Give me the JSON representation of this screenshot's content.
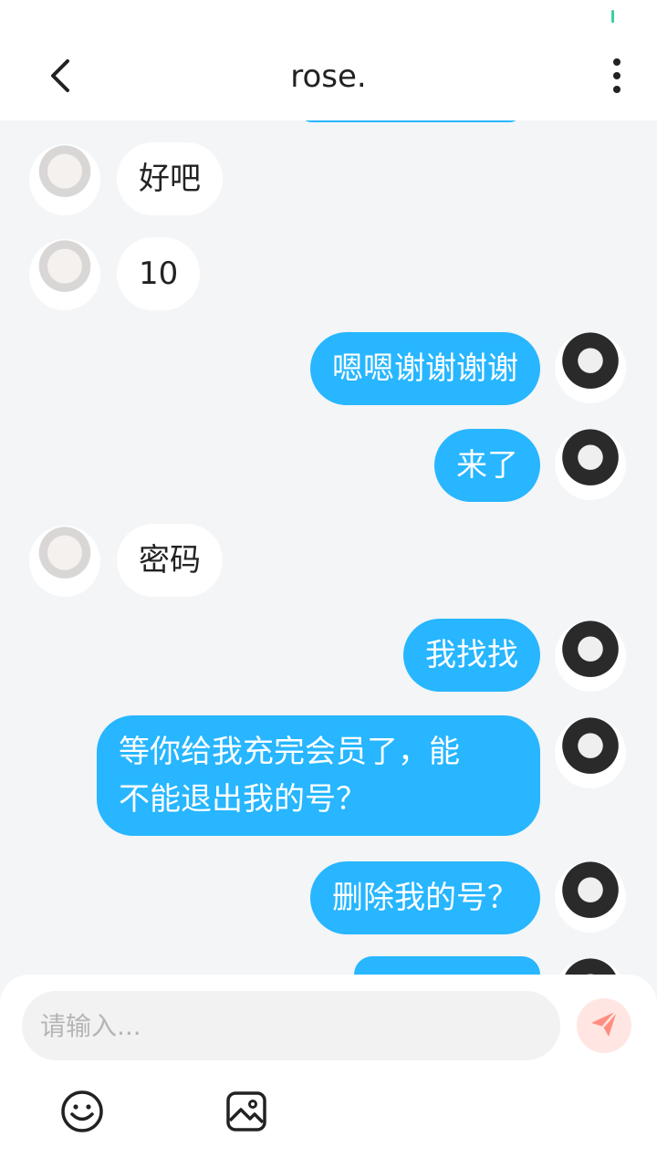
{
  "header": {
    "title": "rose."
  },
  "messages": [
    {
      "side": "in",
      "text": "好吧"
    },
    {
      "side": "in",
      "text": "10"
    },
    {
      "side": "out",
      "text": "嗯嗯谢谢谢谢"
    },
    {
      "side": "out",
      "text": "来了"
    },
    {
      "side": "in",
      "text": "密码"
    },
    {
      "side": "out",
      "text": "我找找"
    },
    {
      "side": "out",
      "text_line1": "等你给我充完会员了，能",
      "text_line2": "不能退出我的号？"
    },
    {
      "side": "out",
      "text": "删除我的号？"
    }
  ],
  "composer": {
    "placeholder": "请输入..."
  },
  "icons": {
    "back": "chevron-left-icon",
    "more": "more-vertical-icon",
    "send": "send-icon",
    "emoji": "emoji-icon",
    "image": "image-icon"
  },
  "colors": {
    "accent_bubble": "#27b6ff",
    "send_bg": "#ffe6e3",
    "send_icon": "#ff8e80"
  }
}
